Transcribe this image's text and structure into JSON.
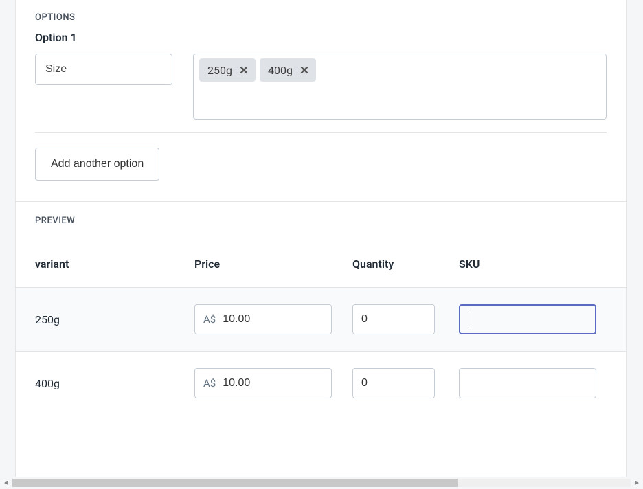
{
  "options_heading": "OPTIONS",
  "option1": {
    "heading": "Option 1",
    "name": "Size",
    "values": [
      "250g",
      "400g"
    ]
  },
  "add_option_label": "Add another option",
  "preview_heading": "PREVIEW",
  "columns": {
    "variant": "variant",
    "price": "Price",
    "quantity": "Quantity",
    "sku": "SKU"
  },
  "currency_prefix": "A$",
  "rows": [
    {
      "variant": "250g",
      "price": "10.00",
      "quantity": "0",
      "sku": "",
      "sku_focused": true
    },
    {
      "variant": "400g",
      "price": "10.00",
      "quantity": "0",
      "sku": ""
    }
  ]
}
